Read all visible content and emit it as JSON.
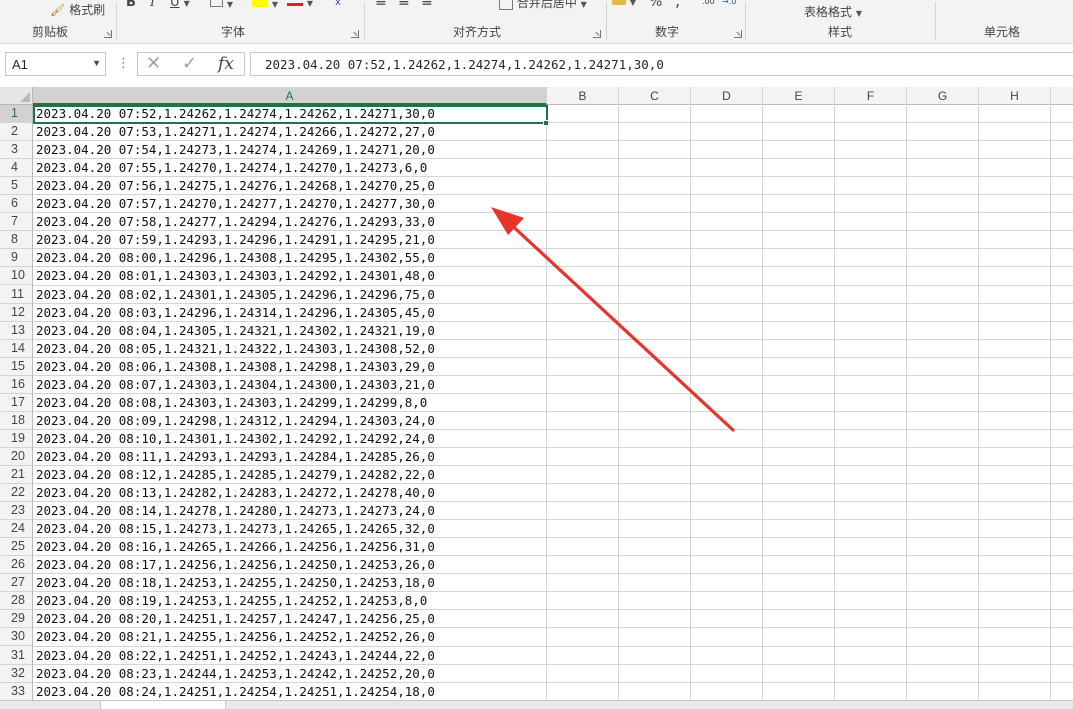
{
  "ribbon": {
    "clipboard": {
      "label": "剪贴板",
      "format_painter": "格式刷"
    },
    "font": {
      "label": "字体",
      "bold": "B",
      "italic": "I",
      "underline": "U"
    },
    "alignment": {
      "label": "对齐方式",
      "merge_center": "合并后居中"
    },
    "number": {
      "label": "数字",
      "percent": "%",
      "comma": ","
    },
    "styles": {
      "label": "样式",
      "table_format": "表格格式"
    },
    "cells": {
      "label": "单元格"
    }
  },
  "formula_bar": {
    "name_box": "A1",
    "fx": "fx",
    "content": "2023.04.20  07:52,1.24262,1.24274,1.24262,1.24271,30,0"
  },
  "sheet": {
    "columns": [
      "A",
      "B",
      "C",
      "D",
      "E",
      "F",
      "G",
      "H"
    ],
    "selected_cell": "A1",
    "rows": [
      "2023.04.20  07:52,1.24262,1.24274,1.24262,1.24271,30,0",
      "2023.04.20  07:53,1.24271,1.24274,1.24266,1.24272,27,0",
      "2023.04.20  07:54,1.24273,1.24274,1.24269,1.24271,20,0",
      "2023.04.20  07:55,1.24270,1.24274,1.24270,1.24273,6,0",
      "2023.04.20  07:56,1.24275,1.24276,1.24268,1.24270,25,0",
      "2023.04.20  07:57,1.24270,1.24277,1.24270,1.24277,30,0",
      "2023.04.20  07:58,1.24277,1.24294,1.24276,1.24293,33,0",
      "2023.04.20  07:59,1.24293,1.24296,1.24291,1.24295,21,0",
      "2023.04.20  08:00,1.24296,1.24308,1.24295,1.24302,55,0",
      "2023.04.20  08:01,1.24303,1.24303,1.24292,1.24301,48,0",
      "2023.04.20  08:02,1.24301,1.24305,1.24296,1.24296,75,0",
      "2023.04.20  08:03,1.24296,1.24314,1.24296,1.24305,45,0",
      "2023.04.20  08:04,1.24305,1.24321,1.24302,1.24321,19,0",
      "2023.04.20  08:05,1.24321,1.24322,1.24303,1.24308,52,0",
      "2023.04.20  08:06,1.24308,1.24308,1.24298,1.24303,29,0",
      "2023.04.20  08:07,1.24303,1.24304,1.24300,1.24303,21,0",
      "2023.04.20  08:08,1.24303,1.24303,1.24299,1.24299,8,0",
      "2023.04.20  08:09,1.24298,1.24312,1.24294,1.24303,24,0",
      "2023.04.20  08:10,1.24301,1.24302,1.24292,1.24292,24,0",
      "2023.04.20  08:11,1.24293,1.24293,1.24284,1.24285,26,0",
      "2023.04.20  08:12,1.24285,1.24285,1.24279,1.24282,22,0",
      "2023.04.20  08:13,1.24282,1.24283,1.24272,1.24278,40,0",
      "2023.04.20  08:14,1.24278,1.24280,1.24273,1.24273,24,0",
      "2023.04.20  08:15,1.24273,1.24273,1.24265,1.24265,32,0",
      "2023.04.20  08:16,1.24265,1.24266,1.24256,1.24256,31,0",
      "2023.04.20  08:17,1.24256,1.24256,1.24250,1.24253,26,0",
      "2023.04.20  08:18,1.24253,1.24255,1.24250,1.24253,18,0",
      "2023.04.20  08:19,1.24253,1.24255,1.24252,1.24253,8,0",
      "2023.04.20  08:20,1.24251,1.24257,1.24247,1.24256,25,0",
      "2023.04.20  08:21,1.24255,1.24256,1.24252,1.24252,26,0",
      "2023.04.20  08:22,1.24251,1.24252,1.24243,1.24244,22,0",
      "2023.04.20  08:23,1.24244,1.24253,1.24242,1.24252,20,0",
      "2023.04.20  08:24,1.24251,1.24254,1.24251,1.24254,18,0"
    ]
  },
  "colors": {
    "accent": "#217346",
    "arrow": "#e8342c",
    "gridline": "#d4d4d4"
  }
}
